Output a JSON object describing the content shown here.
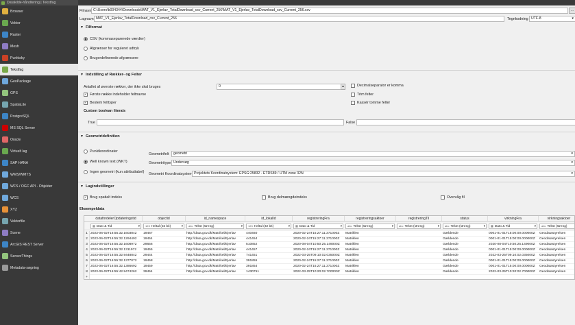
{
  "window": {
    "title": "Datakilde-håndtering | Tekstfag"
  },
  "sidebar": {
    "items": [
      {
        "label": "Browser",
        "color": "#e0b040"
      },
      {
        "label": "Vektor",
        "color": "#6aa84f"
      },
      {
        "label": "Raster",
        "color": "#3d85c6"
      },
      {
        "label": "Mesh",
        "color": "#8e7cc3"
      },
      {
        "label": "Punktsky",
        "color": "#cc4125"
      },
      {
        "label": "Tekstfag",
        "color": "#7aa94a",
        "active": true
      },
      {
        "label": "GeoPackage",
        "color": "#6fa8dc"
      },
      {
        "label": "GPS",
        "color": "#93c47d"
      },
      {
        "label": "SpatiaLite",
        "color": "#76a5af"
      },
      {
        "label": "PostgreSQL",
        "color": "#3d85c6"
      },
      {
        "label": "MS SQL Server",
        "color": "#cc0000"
      },
      {
        "label": "Oracle",
        "color": "#e06666"
      },
      {
        "label": "Virtuelt lag",
        "color": "#6aa84f"
      },
      {
        "label": "SAP HANA",
        "color": "#3d85c6"
      },
      {
        "label": "WMS/WMTS",
        "color": "#6fa8dc"
      },
      {
        "label": "WFS / OGC API - Objekter",
        "color": "#6fa8dc"
      },
      {
        "label": "WCS",
        "color": "#6fa8dc"
      },
      {
        "label": "XYZ",
        "color": "#e69138"
      },
      {
        "label": "Vektorfile",
        "color": "#76a5af"
      },
      {
        "label": "Scene",
        "color": "#8e7cc3"
      },
      {
        "label": "ArcGIS REST Server",
        "color": "#3d85c6"
      },
      {
        "label": "SensorThings",
        "color": "#93c47d"
      },
      {
        "label": "Metadata-søgning",
        "color": "#999999"
      }
    ]
  },
  "file": {
    "filename_label": "Filnavn",
    "filename_value": "C:\\Users\\b004344\\Downloads\\MAT_V1_Ejerlav_TotalDownload_csv_Current_256\\MAT_V1_Ejerlav_TotalDownload_csv_Current_256.csv",
    "browse_label": "…",
    "layername_label": "Lagnavn",
    "layername_value": "MAT_V1_Ejerlav_TotalDownload_csv_Current_256",
    "encoding_label": "Tegnkodning",
    "encoding_value": "UTF-8"
  },
  "fileformat": {
    "title": "Filformat",
    "options": [
      "CSV (kommaseparerede værdier)",
      "Afgrænser for reguleret udtryk",
      "Brugerdefinerede afgrænsere"
    ]
  },
  "rows_fields": {
    "title": "Indstilling af Rækker- og Felter",
    "skip_label": "Antallet af øverste rækker, der ikke skal bruges",
    "skip_value": "0",
    "first_row_header": "Første række indeholder feltnavne",
    "detect_types": "Bestem felttyper",
    "decimal_comma": "Decimalseparator er komma",
    "trim_fields": "Trim felter",
    "discard_empty": "Kassér tomme felter",
    "custom_bool_title": "Custom boolean literals",
    "true_label": "True",
    "false_label": "False"
  },
  "geometry": {
    "title": "Geometridefinition",
    "options": [
      "Punktkoordinater",
      "Well known text (WKT)",
      "Ingen geometri (kun attributtabel)"
    ],
    "field_label": "Geometrifelt",
    "field_value": "geometri",
    "type_label": "Geometritype",
    "type_value": "Undersøg",
    "crs_label": "Geometri Koordinatsystem",
    "crs_value": "Projektets Koordinatsystem: EPSG:25832 - ETRS89 / UTM zone 32N"
  },
  "layer_settings": {
    "title": "Lagindstillinger",
    "spatial_index": "Brug spatialt indeks",
    "subset_index": "Brug delmængdeindeks",
    "watch_file": "Overvåg fil"
  },
  "sample": {
    "title": "Eksempeldata",
    "columns": [
      {
        "name": "datafordelerOpdateringstid",
        "type": "Dato & Tid",
        "icon": "▦"
      },
      {
        "name": "objectid",
        "type": "Heltal (32 bit)",
        "icon": "123"
      },
      {
        "name": "id_namespace",
        "type": "Tekst (streng)",
        "icon": "abc"
      },
      {
        "name": "id_lokalId",
        "type": "Heltal (32 bit)",
        "icon": "123"
      },
      {
        "name": "registreringFra",
        "type": "Dato & Tid",
        "icon": "▦"
      },
      {
        "name": "registreringsaktoer",
        "type": "Tekst (streng)",
        "icon": "abc"
      },
      {
        "name": "registreringTil",
        "type": "Tekst (streng)",
        "icon": "abc"
      },
      {
        "name": "status",
        "type": "Tekst (streng)",
        "icon": "abc"
      },
      {
        "name": "virkningFra",
        "type": "Dato & Tid",
        "icon": "▦"
      },
      {
        "name": "virkningsaktoer",
        "type": "Tekst (streng)",
        "icon": "abc"
      }
    ],
    "rows": [
      [
        "1",
        "2023-06-02T16:55:32.1603842",
        "19467",
        "http://data.gov.dk/Matrikel/Ejerlav",
        "440460",
        "2020-02-24T15:27:11.371000Z",
        "Matriklen",
        "",
        "Gældende",
        "0001-01-01T15:00:00.000000Z",
        "Geodatastyrelsen"
      ],
      [
        "2",
        "2023-06-02T16:55:32.1294492",
        "19454",
        "http://data.gov.dk/Matrikel/Ejerlav",
        "441454",
        "2020-02-24T15:27:11.371000Z",
        "Matriklen",
        "",
        "Gældende",
        "0001-01-01T15:00:00.000000Z",
        "Geodatastyrelsen"
      ],
      [
        "3",
        "2023-06-02T16:55:32.1608972",
        "29656",
        "http://data.gov.dk/Matrikel/Ejerlav",
        "510852",
        "2020-08-04T10:50:25.149000Z",
        "Matriklen",
        "",
        "Gældende",
        "2020-08-04T10:50:25.149000Z",
        "Geodatastyrelsen"
      ],
      [
        "4",
        "2023-06-02T16:55:32.1311972",
        "19455",
        "http://data.gov.dk/Matrikel/Ejerlav",
        "441457",
        "2020-02-24T15:27:11.371000Z",
        "Matriklen",
        "",
        "Gældende",
        "0001-01-01T15:00:00.000000Z",
        "Geodatastyrelsen"
      ],
      [
        "5",
        "2023-06-02T16:55:32.9448842",
        "29444",
        "http://data.gov.dk/Matrikel/Ejerlav",
        "741451",
        "2022-03-25T09:10:02.035000Z",
        "Matriklen",
        "",
        "Gældende",
        "2022-03-25T09:10:02.035000Z",
        "Geodatastyrelsen"
      ],
      [
        "6",
        "2023-06-02T16:55:32.1377072",
        "19458",
        "http://data.gov.dk/Matrikel/Ejerlav",
        "391855",
        "2020-02-24T15:27:11.371000Z",
        "Matriklen",
        "",
        "Gældende",
        "0001-01-01T15:00:00.000000Z",
        "Geodatastyrelsen"
      ],
      [
        "7",
        "2023-06-02T16:55:32.1386692",
        "19459",
        "http://data.gov.dk/Matrikel/Ejerlav",
        "391854",
        "2020-02-24T15:27:11.371000Z",
        "Matriklen",
        "",
        "Gældende",
        "0001-01-01T15:00:00.000000Z",
        "Geodatastyrelsen"
      ],
      [
        "8",
        "2023-06-02T16:55:42.9474262",
        "39454",
        "http://data.gov.dk/Matrikel/Ejerlav",
        "1430751",
        "2022-03-25T10:20:02.700000Z",
        "Matriklen",
        "",
        "Gældende",
        "2022-03-25T10:20:02.700000Z",
        "Geodatastyrelsen"
      ]
    ],
    "more_marker": "+"
  }
}
